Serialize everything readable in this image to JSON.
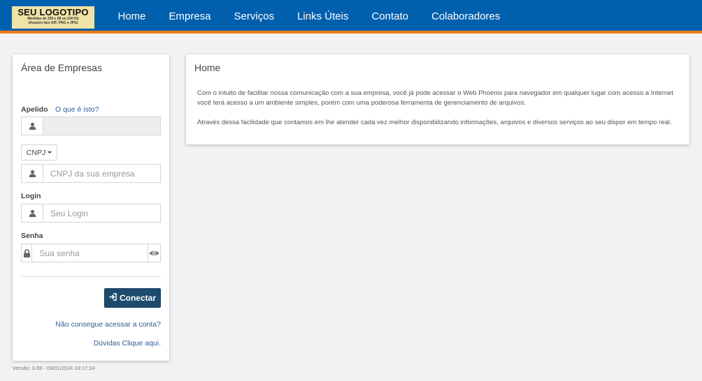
{
  "header": {
    "logo_title": "SEU LOGOTIPO",
    "logo_line1": "Medidas de 250 x 68 ou 100 Kb",
    "logo_line2": "(Arquivo tipo GIF, PNG e JPG)",
    "nav": [
      "Home",
      "Empresa",
      "Serviços",
      "Links Úteis",
      "Contato",
      "Colaboradores"
    ]
  },
  "login": {
    "title": "Área de Empresas",
    "apelido_label": "Apelido",
    "what_link": "O que é isto?",
    "apelido_value": "",
    "cnpj_dropdown": "CNPJ",
    "cnpj_placeholder": "CNPJ da sua empresa",
    "login_label": "Login",
    "login_placeholder": "Seu Login",
    "senha_label": "Senha",
    "senha_placeholder": "Sua senha",
    "connect_label": "Conectar",
    "forgot_link": "Não consegue acessar a conta?",
    "help_link": "Dúvidas Clique aqui."
  },
  "home": {
    "title": "Home",
    "paragraph1": "Com o intuito de facilitar nossa comunicação com a sua empresa, você já pode acessar o Web Phoenix para navegador em qualquer lugar com acesso a Internet você terá acesso a um ambiente simples, porém com uma poderosa ferramenta de gerenciamento de arquivos.",
    "paragraph2": "Através dessa facilidade que contamos em lhe atender cada vez melhor disponibilizando informações, arquivos e diversos serviços ao seu dispor em tempo real."
  },
  "footer": {
    "version": "Versão: 3.69 - 08/01/2024 18:17:24"
  },
  "colors": {
    "navbar": "#0060ae",
    "accent_stripe": "#f07a1a",
    "logo_bg": "#efe3a8",
    "button": "#1d4b6e",
    "link": "#2a5c9a"
  },
  "icons": {
    "user": "user-icon",
    "lock": "lock-icon",
    "eye": "eye-icon",
    "sign_in": "sign-in-icon",
    "caret": "caret-down-icon"
  }
}
